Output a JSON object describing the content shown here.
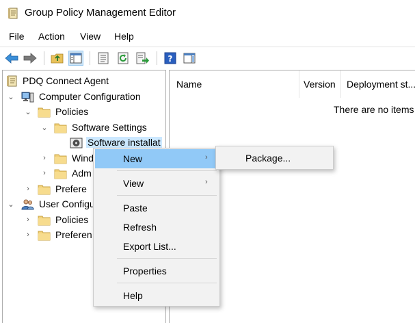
{
  "window": {
    "title": "Group Policy Management Editor"
  },
  "menubar": {
    "items": [
      "File",
      "Action",
      "View",
      "Help"
    ]
  },
  "toolbar": {
    "buttons": [
      "back-arrow-icon",
      "forward-arrow-icon",
      "up-folder-icon",
      "show-hide-tree-icon",
      "properties-icon",
      "refresh-icon",
      "export-list-icon",
      "help-icon",
      "show-hide-action-pane-icon"
    ]
  },
  "tree": {
    "root": "PDQ Connect Agent",
    "computer_configuration": "Computer Configuration",
    "policies": "Policies",
    "software_settings": "Software Settings",
    "software_installation": "Software installat",
    "windows_settings": "Wind",
    "admin_templates": "Adm",
    "preferences": "Prefere",
    "user_configuration": "User Configu",
    "user_policies": "Policies",
    "user_preferences": "Preferen"
  },
  "list": {
    "columns": [
      "Name",
      "Version",
      "Deployment st..."
    ],
    "empty_message": "There are no items"
  },
  "context_menu": {
    "new": "New",
    "view": "View",
    "paste": "Paste",
    "refresh": "Refresh",
    "export_list": "Export List...",
    "properties": "Properties",
    "help": "Help"
  },
  "submenu": {
    "package": "Package..."
  },
  "colors": {
    "menu_highlight": "#91c9f7",
    "menu_background": "#f2f2f2",
    "selection": "#cce8ff"
  }
}
